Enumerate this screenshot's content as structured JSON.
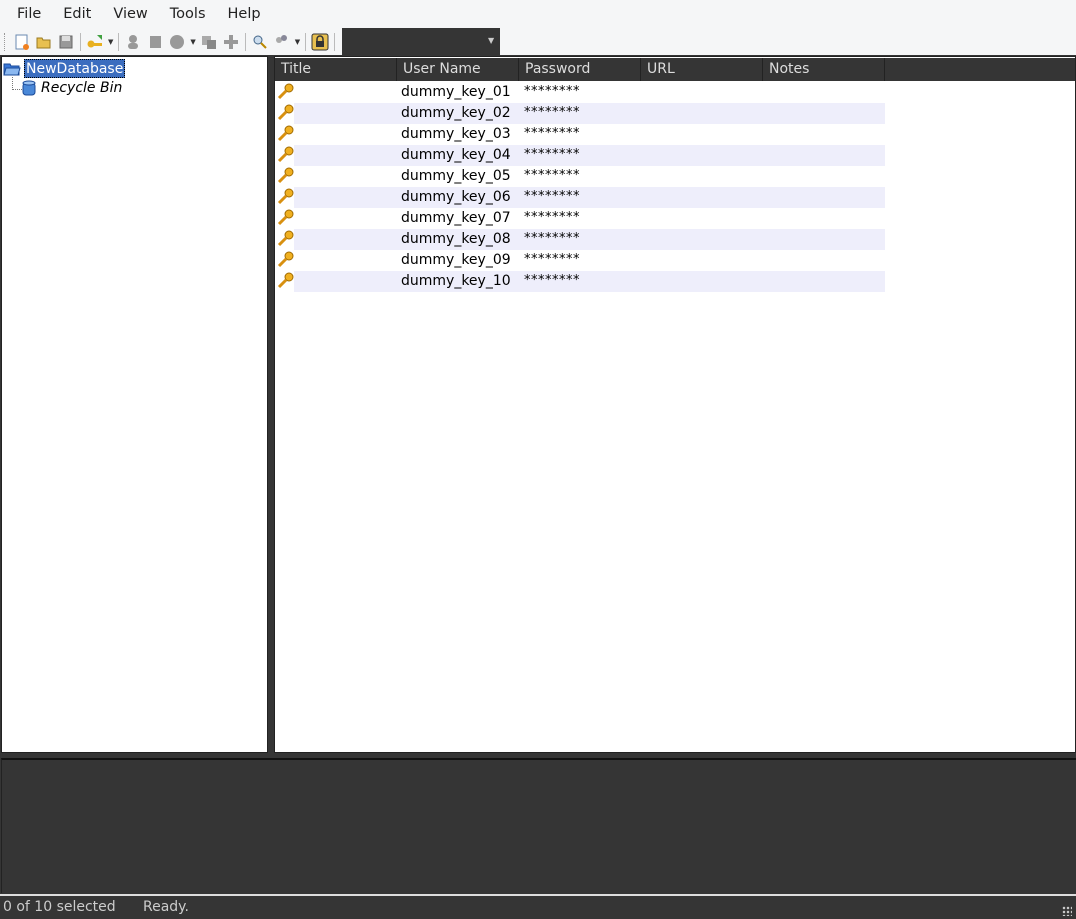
{
  "menu": [
    "File",
    "Edit",
    "View",
    "Tools",
    "Help"
  ],
  "toolbar": {
    "icons": [
      "new-database-icon",
      "open-database-icon",
      "save-icon",
      "add-entry-icon",
      "edit-entry-icon",
      "delete-entry-icon",
      "group-icon",
      "copy-username-icon",
      "copy-password-icon",
      "find-icon",
      "generate-icon",
      "lock-icon"
    ],
    "quick_find": ""
  },
  "tree": {
    "root": "NewDatabase",
    "recycle": "Recycle Bin"
  },
  "list": {
    "columns": [
      "Title",
      "User Name",
      "Password",
      "URL",
      "Notes"
    ],
    "rows": [
      {
        "title": "",
        "user": "dummy_key_01",
        "password": "********",
        "url": "",
        "notes": ""
      },
      {
        "title": "",
        "user": "dummy_key_02",
        "password": "********",
        "url": "",
        "notes": ""
      },
      {
        "title": "",
        "user": "dummy_key_03",
        "password": "********",
        "url": "",
        "notes": ""
      },
      {
        "title": "",
        "user": "dummy_key_04",
        "password": "********",
        "url": "",
        "notes": ""
      },
      {
        "title": "",
        "user": "dummy_key_05",
        "password": "********",
        "url": "",
        "notes": ""
      },
      {
        "title": "",
        "user": "dummy_key_06",
        "password": "********",
        "url": "",
        "notes": ""
      },
      {
        "title": "",
        "user": "dummy_key_07",
        "password": "********",
        "url": "",
        "notes": ""
      },
      {
        "title": "",
        "user": "dummy_key_08",
        "password": "********",
        "url": "",
        "notes": ""
      },
      {
        "title": "",
        "user": "dummy_key_09",
        "password": "********",
        "url": "",
        "notes": ""
      },
      {
        "title": "",
        "user": "dummy_key_10",
        "password": "********",
        "url": "",
        "notes": ""
      }
    ]
  },
  "status": {
    "selection": "0 of 10 selected",
    "state": "Ready."
  },
  "colors": {
    "selection": "#3b6dbf",
    "stripe": "#eeeefb",
    "dark": "#353535"
  }
}
